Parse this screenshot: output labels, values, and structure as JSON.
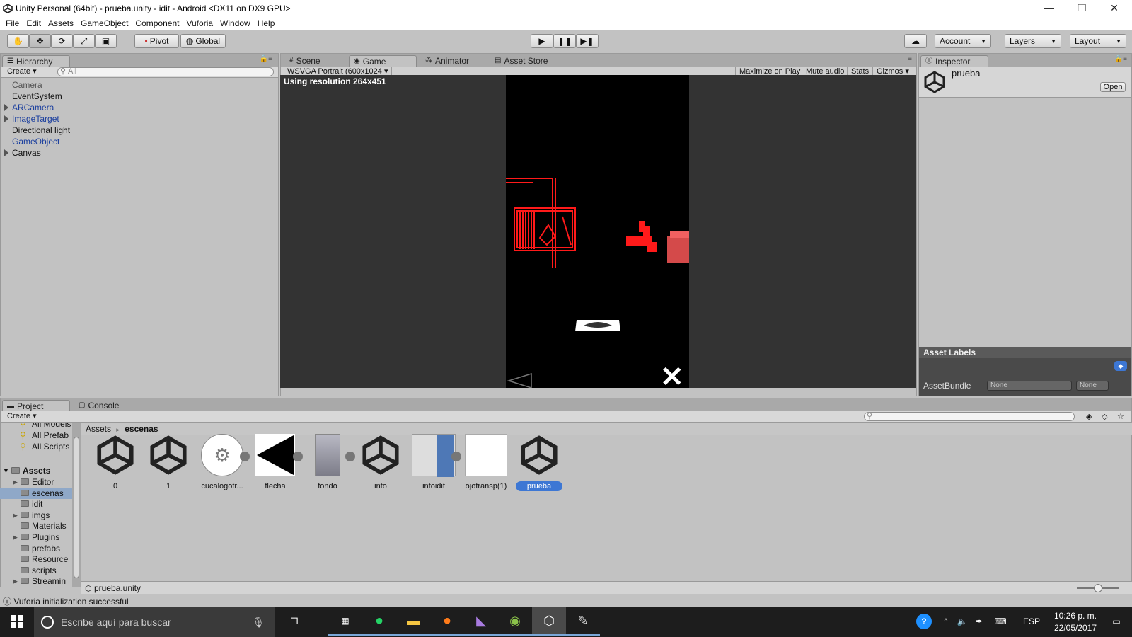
{
  "window": {
    "title": "Unity Personal (64bit) - prueba.unity - idit - Android <DX11 on DX9 GPU>",
    "minimize": "—",
    "restore": "❐",
    "close": "✕"
  },
  "menu": [
    "File",
    "Edit",
    "Assets",
    "GameObject",
    "Component",
    "Vuforia",
    "Window",
    "Help"
  ],
  "toolbar": {
    "pivot": "Pivot",
    "global": "Global",
    "account": "Account",
    "layers": "Layers",
    "layout": "Layout"
  },
  "hierarchy": {
    "tab": "Hierarchy",
    "create": "Create",
    "search_placeholder": "All",
    "items": [
      {
        "label": "Camera",
        "expandable": false,
        "style": "gray"
      },
      {
        "label": "EventSystem",
        "expandable": false,
        "style": "normal"
      },
      {
        "label": "ARCamera",
        "expandable": true,
        "style": "blue"
      },
      {
        "label": "ImageTarget",
        "expandable": true,
        "style": "blue"
      },
      {
        "label": "Directional light",
        "expandable": false,
        "style": "normal"
      },
      {
        "label": "GameObject",
        "expandable": false,
        "style": "blue"
      },
      {
        "label": "Canvas",
        "expandable": true,
        "style": "normal"
      }
    ]
  },
  "center_tabs": [
    "Scene",
    "Game",
    "Animator",
    "Asset Store"
  ],
  "game": {
    "resolution_select": "WSVGA Portrait (600x1024",
    "maximize": "Maximize on Play",
    "mute": "Mute audio",
    "stats": "Stats",
    "gizmos": "Gizmos",
    "resolution_note": "Using resolution 264x451",
    "close_glyph": "✕"
  },
  "inspector": {
    "tab": "Inspector",
    "object_name": "prueba",
    "open_button": "Open",
    "asset_labels": "Asset Labels",
    "assetbundle_label": "AssetBundle",
    "assetbundle_value": "None",
    "variant_value": "None"
  },
  "project": {
    "tab": "Project",
    "console_tab": "Console",
    "create": "Create",
    "favorites": [
      "All Models",
      "All Prefab",
      "All Scripts"
    ],
    "assets_root": "Assets",
    "folders": [
      {
        "label": "Editor",
        "expandable": true,
        "selected": false
      },
      {
        "label": "escenas",
        "expandable": false,
        "selected": true
      },
      {
        "label": "idit",
        "expandable": false,
        "selected": false
      },
      {
        "label": "imgs",
        "expandable": true,
        "selected": false
      },
      {
        "label": "Materials",
        "expandable": false,
        "selected": false
      },
      {
        "label": "Plugins",
        "expandable": true,
        "selected": false
      },
      {
        "label": "prefabs",
        "expandable": false,
        "selected": false
      },
      {
        "label": "Resource",
        "expandable": false,
        "selected": false
      },
      {
        "label": "scripts",
        "expandable": false,
        "selected": false
      },
      {
        "label": "Streamin",
        "expandable": true,
        "selected": false
      }
    ],
    "breadcrumb_root": "Assets",
    "breadcrumb_sep": "▸",
    "breadcrumb_current": "escenas",
    "assets": [
      {
        "label": "0",
        "icon": "unity-scene-icon"
      },
      {
        "label": "1",
        "icon": "unity-scene-icon"
      },
      {
        "label": "cucalogotr...",
        "icon": "robot-arm-image-icon"
      },
      {
        "label": "flecha",
        "icon": "arrow-image-icon"
      },
      {
        "label": "fondo",
        "icon": "photo-image-icon"
      },
      {
        "label": "info",
        "icon": "unity-scene-icon"
      },
      {
        "label": "infoidit",
        "icon": "document-image-icon"
      },
      {
        "label": "ojotransp(1)",
        "icon": "blank-image-icon"
      },
      {
        "label": "prueba",
        "icon": "unity-scene-icon"
      }
    ],
    "selected_path": "prueba.unity"
  },
  "status": {
    "message": "Vuforia initialization successful"
  },
  "taskbar": {
    "search_placeholder": "Escribe aquí para buscar",
    "lang": "ESP",
    "time": "10:26 p. m.",
    "date": "22/05/2017"
  }
}
